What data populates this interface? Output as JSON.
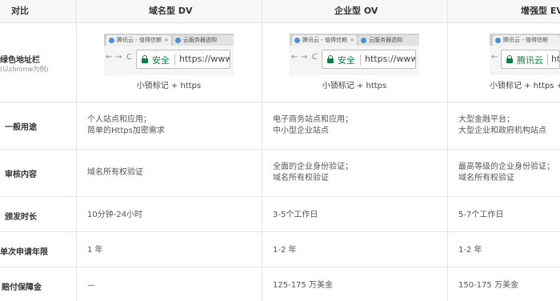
{
  "header": {
    "col0": "对比",
    "col1": "域名型 DV",
    "col2": "企业型 OV",
    "col3": "增强型 EV"
  },
  "rows": {
    "address_bar": {
      "label": "绿色地址栏",
      "sublabel": "以chrome为例",
      "dv": {
        "tab1": "腾讯云 - 值得信赖",
        "tab2": "云服务器选购",
        "secure": "安全",
        "url": "https://www",
        "caption": "小锁标记 + https"
      },
      "ov": {
        "tab1": "腾讯云 - 值得信赖",
        "tab2": "云服务器选购",
        "secure": "安全",
        "url": "https://www",
        "caption": "小锁标记 + https"
      },
      "ev": {
        "tab1": "腾讯云 - 值得信赖",
        "secure": "腾讯云",
        "url": "https://",
        "caption": "小锁标记 + https + 公"
      }
    },
    "usage": {
      "label": "一般用途",
      "dv_line1": "个人站点和应用；",
      "dv_line2": "简单的Https加密需求",
      "ov_line1": "电子商务站点和应用；",
      "ov_line2": "中小型企业站点",
      "ev_line1": "大型金融平台；",
      "ev_line2": "大型企业和政府机构站点"
    },
    "audit": {
      "label": "审核内容",
      "dv_line1": "域名所有权验证",
      "ov_line1": "全面的企业身份验证；",
      "ov_line2": "域名所有权验证",
      "ev_line1": "最高等级的企业身份验证；",
      "ev_line2": "域名所有权验证"
    },
    "issue_time": {
      "label": "颁发时长",
      "dv": "10分钟-24小时",
      "ov": "3-5个工作日",
      "ev": "5-7个工作日"
    },
    "years": {
      "label": "单次申请年限",
      "dv": "1 年",
      "ov": "1-2 年",
      "ev": "1-2 年"
    },
    "warranty": {
      "label": "赔付保障金",
      "dv": "—",
      "ov": "125-175 万美金",
      "ev": "150-175 万美金"
    }
  },
  "nav_icons": {
    "back": "←",
    "forward": "→",
    "reload": "C"
  },
  "colors": {
    "secure_green": "#0b8043",
    "border": "#e4e4e4",
    "header_bg": "#f7f7f7"
  }
}
